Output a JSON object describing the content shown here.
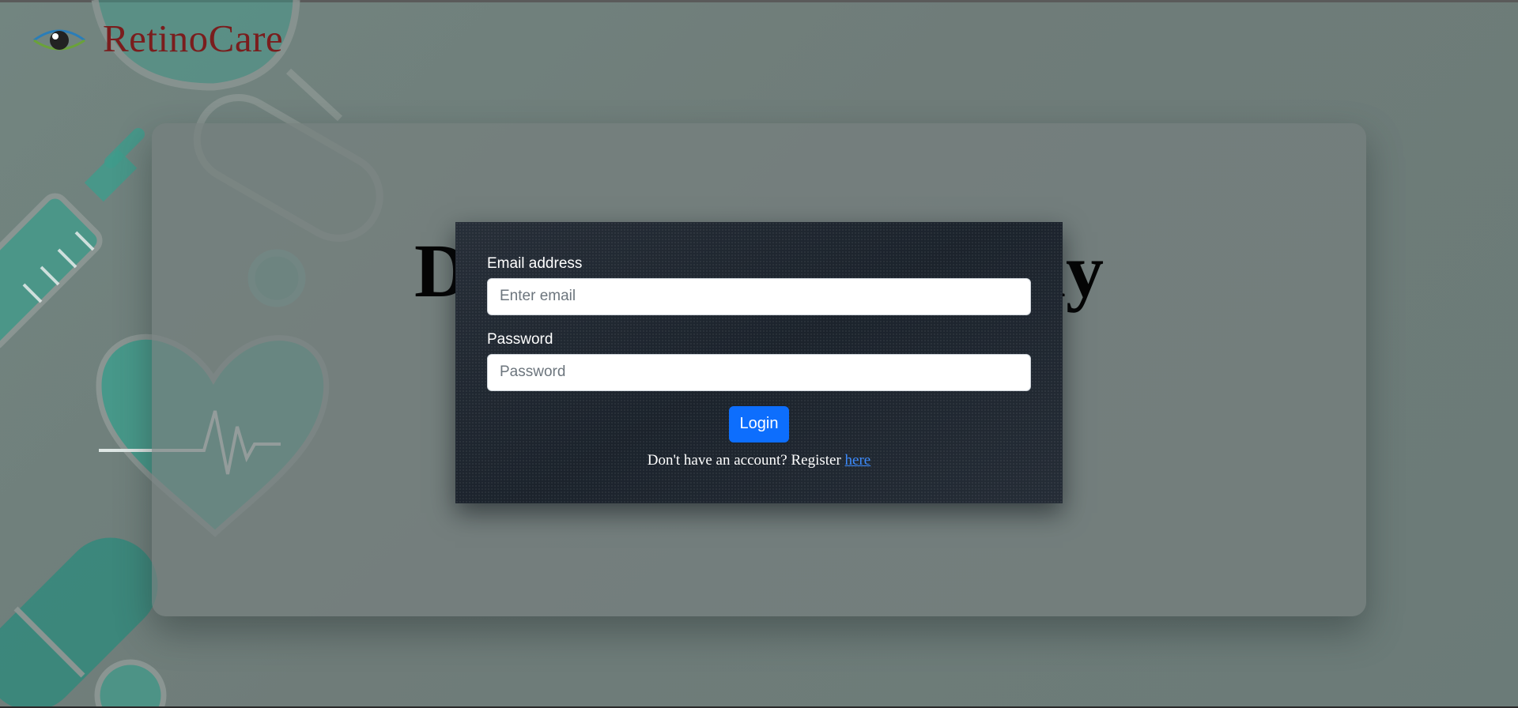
{
  "brand": {
    "name": "RetinoCare",
    "logo_icon": "eye-icon",
    "name_color": "#7a1d1d"
  },
  "hero": {
    "title": "Diabetic Retinopathy"
  },
  "login_form": {
    "email_label": "Email address",
    "email_placeholder": "Enter email",
    "email_value": "",
    "password_label": "Password",
    "password_placeholder": "Password",
    "password_value": "",
    "login_label": "Login",
    "register_prompt": "Don't have an account? Register",
    "register_link": "here",
    "accent_color": "#0d6efd"
  },
  "background": {
    "decor_icons": [
      "stethoscope-icon",
      "syringe-icon",
      "heart-pulse-icon",
      "pill-capsule-icon"
    ],
    "decor_color": "#3f9c8c"
  }
}
